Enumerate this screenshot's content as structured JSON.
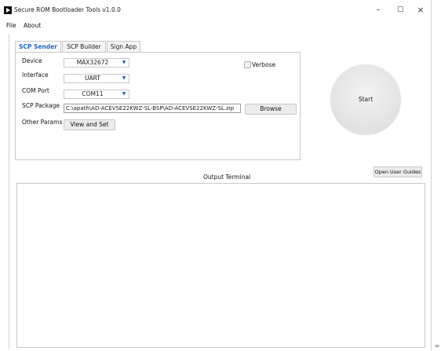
{
  "window": {
    "title": "Secure ROM Bootloader Tools v1.0.0",
    "minimize_glyph": "–",
    "maximize_glyph": "☐",
    "close_glyph": "×"
  },
  "menu": {
    "items": [
      "File",
      "About"
    ]
  },
  "tabs": [
    {
      "label": "SCP Sender",
      "active": true
    },
    {
      "label": "SCP Builder",
      "active": false
    },
    {
      "label": "Sign App",
      "active": false
    }
  ],
  "form": {
    "device": {
      "label": "Device",
      "value": "MAX32672"
    },
    "interface": {
      "label": "Interface",
      "value": "UART"
    },
    "com_port": {
      "label": "COM Port",
      "value": "COM11"
    },
    "scp_package": {
      "label": "SCP Package",
      "value": "C:\\apath\\AD-ACEVSE22KWZ-SL-BSP\\AD-ACEVSE22KWZ-SL.zip",
      "browse_label": "Browse"
    },
    "other_params": {
      "label": "Other Params",
      "button_label": "View and Set"
    },
    "verbose": {
      "label": "Verbose",
      "checked": false
    }
  },
  "start_button": {
    "label": "Start"
  },
  "open_guides_button": {
    "label": "Open User Guides"
  },
  "output_terminal": {
    "label": "Output Terminal",
    "content": ""
  },
  "corner_mark": "ß",
  "colors": {
    "accent": "#1f66c2",
    "border": "#c8c8c8"
  }
}
